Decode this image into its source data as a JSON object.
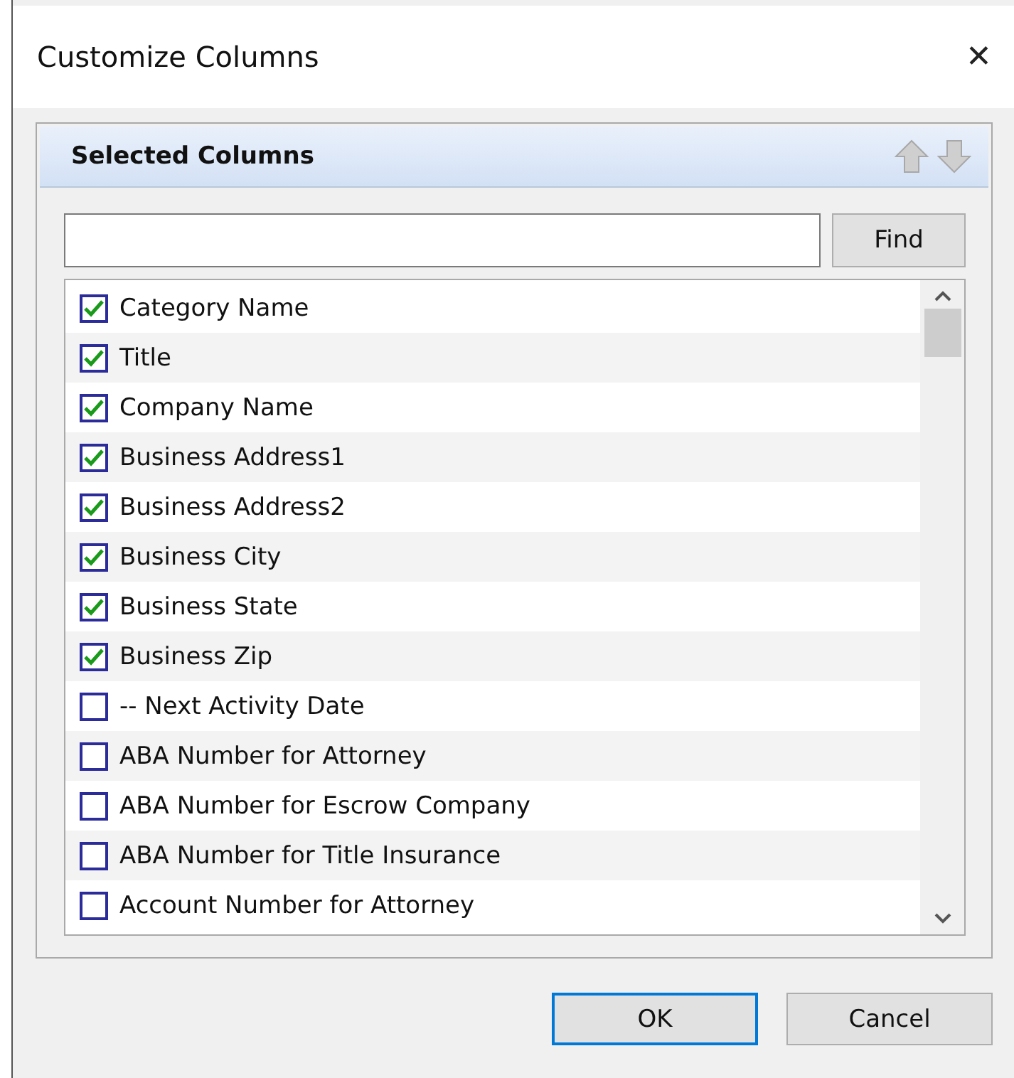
{
  "window": {
    "title": "Customize Columns",
    "close": "✕"
  },
  "panel": {
    "title": "Selected Columns"
  },
  "search": {
    "button": "Find"
  },
  "columns": [
    {
      "label": "Category Name",
      "checked": true
    },
    {
      "label": "Title",
      "checked": true
    },
    {
      "label": "Company Name",
      "checked": true
    },
    {
      "label": "Business Address1",
      "checked": true
    },
    {
      "label": "Business Address2",
      "checked": true
    },
    {
      "label": "Business City",
      "checked": true
    },
    {
      "label": "Business State",
      "checked": true
    },
    {
      "label": "Business Zip",
      "checked": true
    },
    {
      "label": "-- Next Activity Date",
      "checked": false
    },
    {
      "label": "ABA Number for Attorney",
      "checked": false
    },
    {
      "label": "ABA Number for Escrow Company",
      "checked": false
    },
    {
      "label": "ABA Number for Title Insurance",
      "checked": false
    },
    {
      "label": "Account Number for Attorney",
      "checked": false
    }
  ],
  "buttons": [
    {
      "label": "OK",
      "default": true
    },
    {
      "label": "Cancel",
      "default": false
    }
  ]
}
